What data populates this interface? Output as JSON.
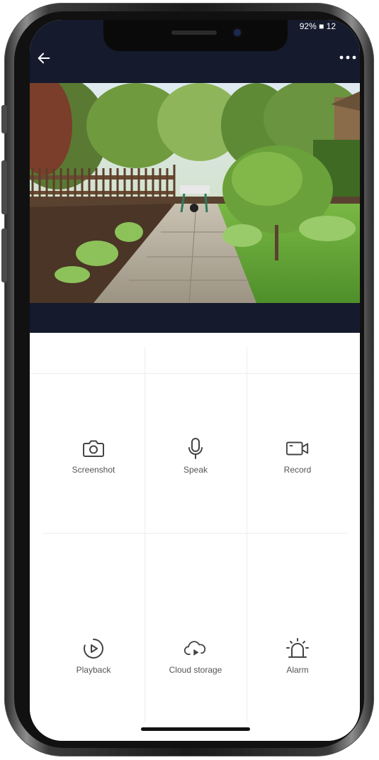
{
  "status_bar": {
    "text": "92% ■ 12"
  },
  "header": {
    "back_icon": "arrow-left-icon",
    "menu_icon": "more-horizontal-icon"
  },
  "video": {
    "description_icon": "camera-feed"
  },
  "controls": [
    {
      "label": "Screenshot",
      "icon": "camera-icon"
    },
    {
      "label": "Speak",
      "icon": "microphone-icon"
    },
    {
      "label": "Record",
      "icon": "video-camera-icon"
    },
    {
      "label": "Playback",
      "icon": "playback-icon"
    },
    {
      "label": "Cloud storage",
      "icon": "cloud-play-icon"
    },
    {
      "label": "Alarm",
      "icon": "siren-icon"
    }
  ],
  "colors": {
    "header_bg": "#151b2d",
    "icon": "#444444",
    "label": "#555555"
  }
}
